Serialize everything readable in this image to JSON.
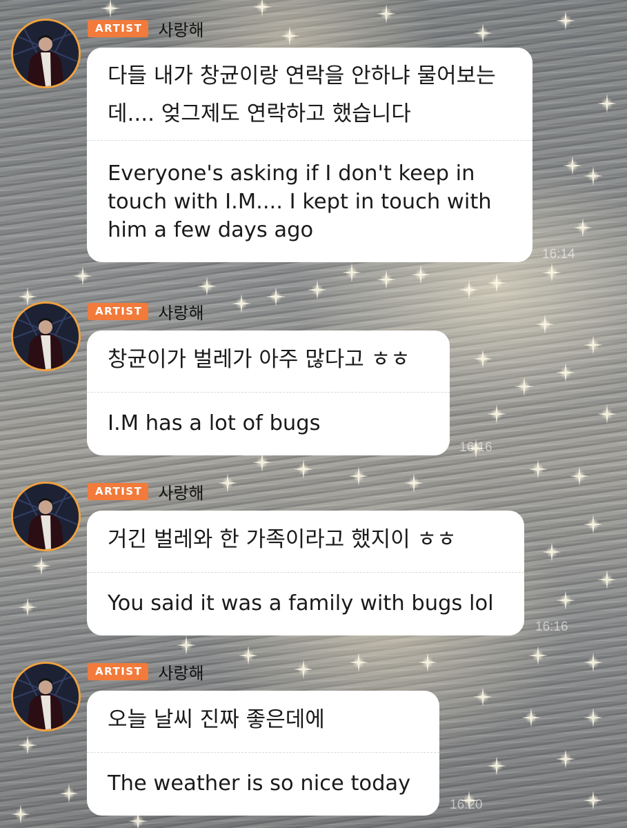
{
  "messages": [
    {
      "badge": "ARTIST",
      "sender": "사랑해",
      "korean": "다들 내가 창균이랑 연락을 안하냐 물어보는데.... 엊그제도 연락하고 했습니다",
      "korean_lines": [
        "다들 내가 창균이랑 연락을 안하냐 물어보는",
        "데.... 엊그제도 연락하고 했습니다"
      ],
      "english_lines": [
        "Everyone's asking if I don't keep in",
        "touch with I.M.... I kept in touch with",
        "him a few days ago"
      ],
      "time": "16:14"
    },
    {
      "badge": "ARTIST",
      "sender": "사랑해",
      "korean_lines": [
        "창균이가 벌레가 아주 많다고 ㅎㅎ"
      ],
      "english_lines": [
        "I.M has a lot of bugs"
      ],
      "time": "16:16"
    },
    {
      "badge": "ARTIST",
      "sender": "사랑해",
      "korean_lines": [
        "거긴 벌레와 한 가족이라고 했지이 ㅎㅎ"
      ],
      "english_lines": [
        "You said it was a family with bugs lol"
      ],
      "time": "16:16"
    },
    {
      "badge": "ARTIST",
      "sender": "사랑해",
      "korean_lines": [
        "오늘 날씨 진짜 좋은데에"
      ],
      "english_lines": [
        "The weather is so nice today"
      ],
      "time": "16:20"
    }
  ],
  "colors": {
    "badge": "#f27a3a",
    "avatar_ring": "#f0a13f",
    "bubble": "#ffffff"
  }
}
